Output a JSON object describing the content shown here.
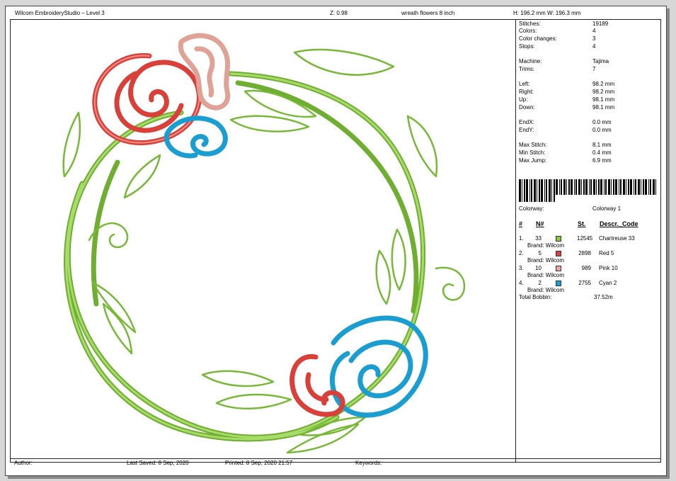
{
  "header": {
    "app": "Wilcom EmbroideryStudio – Level 3",
    "zoom": "Z: 0.98",
    "design_name": "wreath flowers 8 inch",
    "dimensions": "H: 196.2 mm   W: 196.3 mm"
  },
  "stats": [
    {
      "label": "Stitches:",
      "value": "19189"
    },
    {
      "label": "Colors:",
      "value": "4"
    },
    {
      "label": "Color changes:",
      "value": "3"
    },
    {
      "label": "Stops:",
      "value": "4"
    },
    {
      "label": "Machine:",
      "value": "Tajima"
    },
    {
      "label": "Trims:",
      "value": "7"
    },
    {
      "label": "Left:",
      "value": "98.2 mm"
    },
    {
      "label": "Right:",
      "value": "98.2 mm"
    },
    {
      "label": "Up:",
      "value": "98.1 mm"
    },
    {
      "label": "Down:",
      "value": "98.1 mm"
    },
    {
      "label": "EndX:",
      "value": "0.0 mm"
    },
    {
      "label": "EndY:",
      "value": "0.0 mm"
    },
    {
      "label": "Max Stitch:",
      "value": "8.1 mm"
    },
    {
      "label": "Min Stitch:",
      "value": "0.4 mm"
    },
    {
      "label": "Max Jump:",
      "value": "6.9 mm"
    }
  ],
  "colorway": {
    "label": "Colorway:",
    "value": "Colorway 1"
  },
  "color_table": {
    "headers": {
      "num": "#",
      "n": "N#",
      "st": "St.",
      "descr": "Descr._Code"
    },
    "rows": [
      {
        "idx": "1.",
        "n": "33",
        "color": "#8dc63f",
        "st": "12545",
        "descr": "Chartreuse 33",
        "brand": "Brand: Wilcom"
      },
      {
        "idx": "2.",
        "n": "5",
        "color": "#d9403a",
        "st": "2898",
        "descr": "Red 5",
        "brand": "Brand: Wilcom"
      },
      {
        "idx": "3.",
        "n": "10",
        "color": "#e8aaa0",
        "st": "989",
        "descr": "Pink 10",
        "brand": "Brand: Wilcom"
      },
      {
        "idx": "4.",
        "n": "2",
        "color": "#1a9ccf",
        "st": "2755",
        "descr": "Cyan 2",
        "brand": "Brand: Wilcom"
      }
    ],
    "total_label": "Total Bobbin:",
    "total_value": "37.52m"
  },
  "footer": {
    "author": "Author:",
    "last_saved": "Last Saved:  8 Sep, 2020",
    "printed": "Printed:  8 Sep, 2020 21:57",
    "keywords": "Keywords:"
  },
  "colors": {
    "green": "#8ccb44",
    "red": "#d9403a",
    "pink": "#e8a99c",
    "cyan": "#1a9dd0"
  }
}
